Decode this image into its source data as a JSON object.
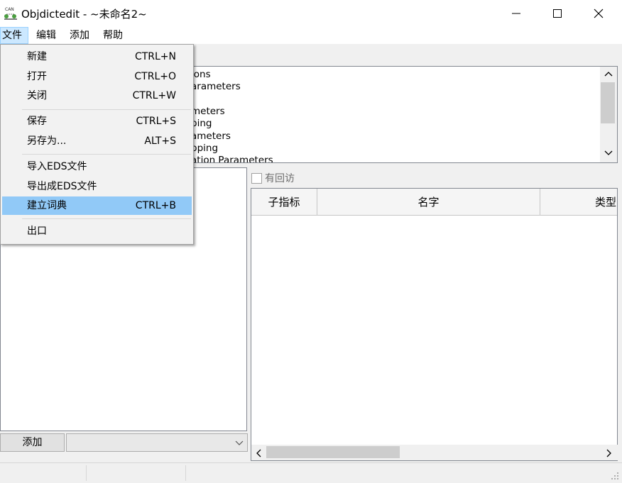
{
  "window": {
    "title": "Objdictedit - ~未命名2~",
    "minimize": "—",
    "maximize": "☐",
    "close": "✕"
  },
  "menubar": {
    "items": [
      "文件",
      "编辑",
      "添加",
      "帮助"
    ]
  },
  "file_menu": {
    "items": [
      {
        "label": "新建",
        "shortcut": "CTRL+N"
      },
      {
        "label": "打开",
        "shortcut": "CTRL+O"
      },
      {
        "label": "关闭",
        "shortcut": "CTRL+W"
      },
      {
        "label": "保存",
        "shortcut": "CTRL+S"
      },
      {
        "label": "另存为...",
        "shortcut": "ALT+S"
      },
      {
        "label": "导入EDS文件",
        "shortcut": ""
      },
      {
        "label": "导出成EDS文件",
        "shortcut": ""
      },
      {
        "label": "建立词典",
        "shortcut": "CTRL+B"
      },
      {
        "label": "出口",
        "shortcut": ""
      }
    ],
    "highlighted_index": 7
  },
  "top_list": {
    "rows": [
      "ions",
      "arameters",
      "",
      "meters",
      "ping",
      "ameters",
      "pping",
      "ation Parameters"
    ]
  },
  "left_pane": {
    "add_button": "添加",
    "combo_value": ""
  },
  "right_pane": {
    "callback_label": "有回访",
    "columns": [
      "子指标",
      "名字",
      "类型"
    ]
  },
  "colors": {
    "highlight": "#91c9f7",
    "menu_active": "#cce8ff"
  }
}
